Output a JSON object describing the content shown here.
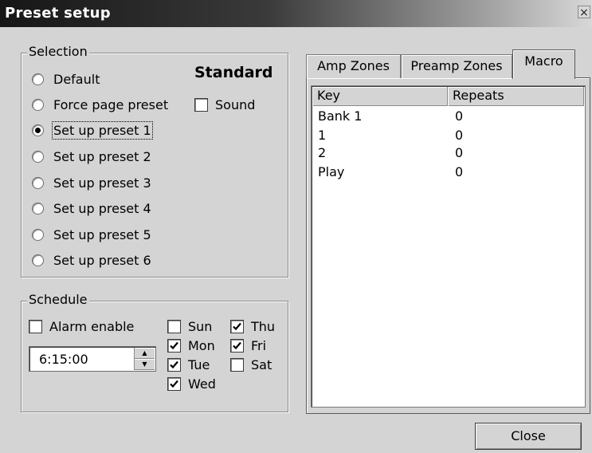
{
  "window": {
    "title": "Preset setup",
    "close_glyph": "×"
  },
  "selection": {
    "legend": "Selection",
    "mode_label": "Standard",
    "options": [
      {
        "label": "Default",
        "checked": false
      },
      {
        "label": "Force page preset",
        "checked": false
      },
      {
        "label": "Set up preset 1",
        "checked": true
      },
      {
        "label": "Set up preset 2",
        "checked": false
      },
      {
        "label": "Set up preset 3",
        "checked": false
      },
      {
        "label": "Set up preset 4",
        "checked": false
      },
      {
        "label": "Set up preset 5",
        "checked": false
      },
      {
        "label": "Set up preset 6",
        "checked": false
      }
    ],
    "sound": {
      "label": "Sound",
      "checked": false
    }
  },
  "schedule": {
    "legend": "Schedule",
    "alarm": {
      "label": "Alarm enable",
      "checked": false
    },
    "time": "6:15:00",
    "days": [
      {
        "label": "Sun",
        "checked": false
      },
      {
        "label": "Mon",
        "checked": true
      },
      {
        "label": "Tue",
        "checked": true
      },
      {
        "label": "Wed",
        "checked": true
      },
      {
        "label": "Thu",
        "checked": true
      },
      {
        "label": "Fri",
        "checked": true
      },
      {
        "label": "Sat",
        "checked": false
      }
    ]
  },
  "tabs": [
    {
      "label": "Amp Zones",
      "active": false
    },
    {
      "label": "Preamp Zones",
      "active": false
    },
    {
      "label": "Macro",
      "active": true
    }
  ],
  "macro_table": {
    "columns": [
      "Key",
      "Repeats"
    ],
    "rows": [
      [
        "Bank 1",
        "0"
      ],
      [
        "1",
        "0"
      ],
      [
        "2",
        "0"
      ],
      [
        "Play",
        "0"
      ]
    ]
  },
  "buttons": {
    "close": "Close"
  }
}
